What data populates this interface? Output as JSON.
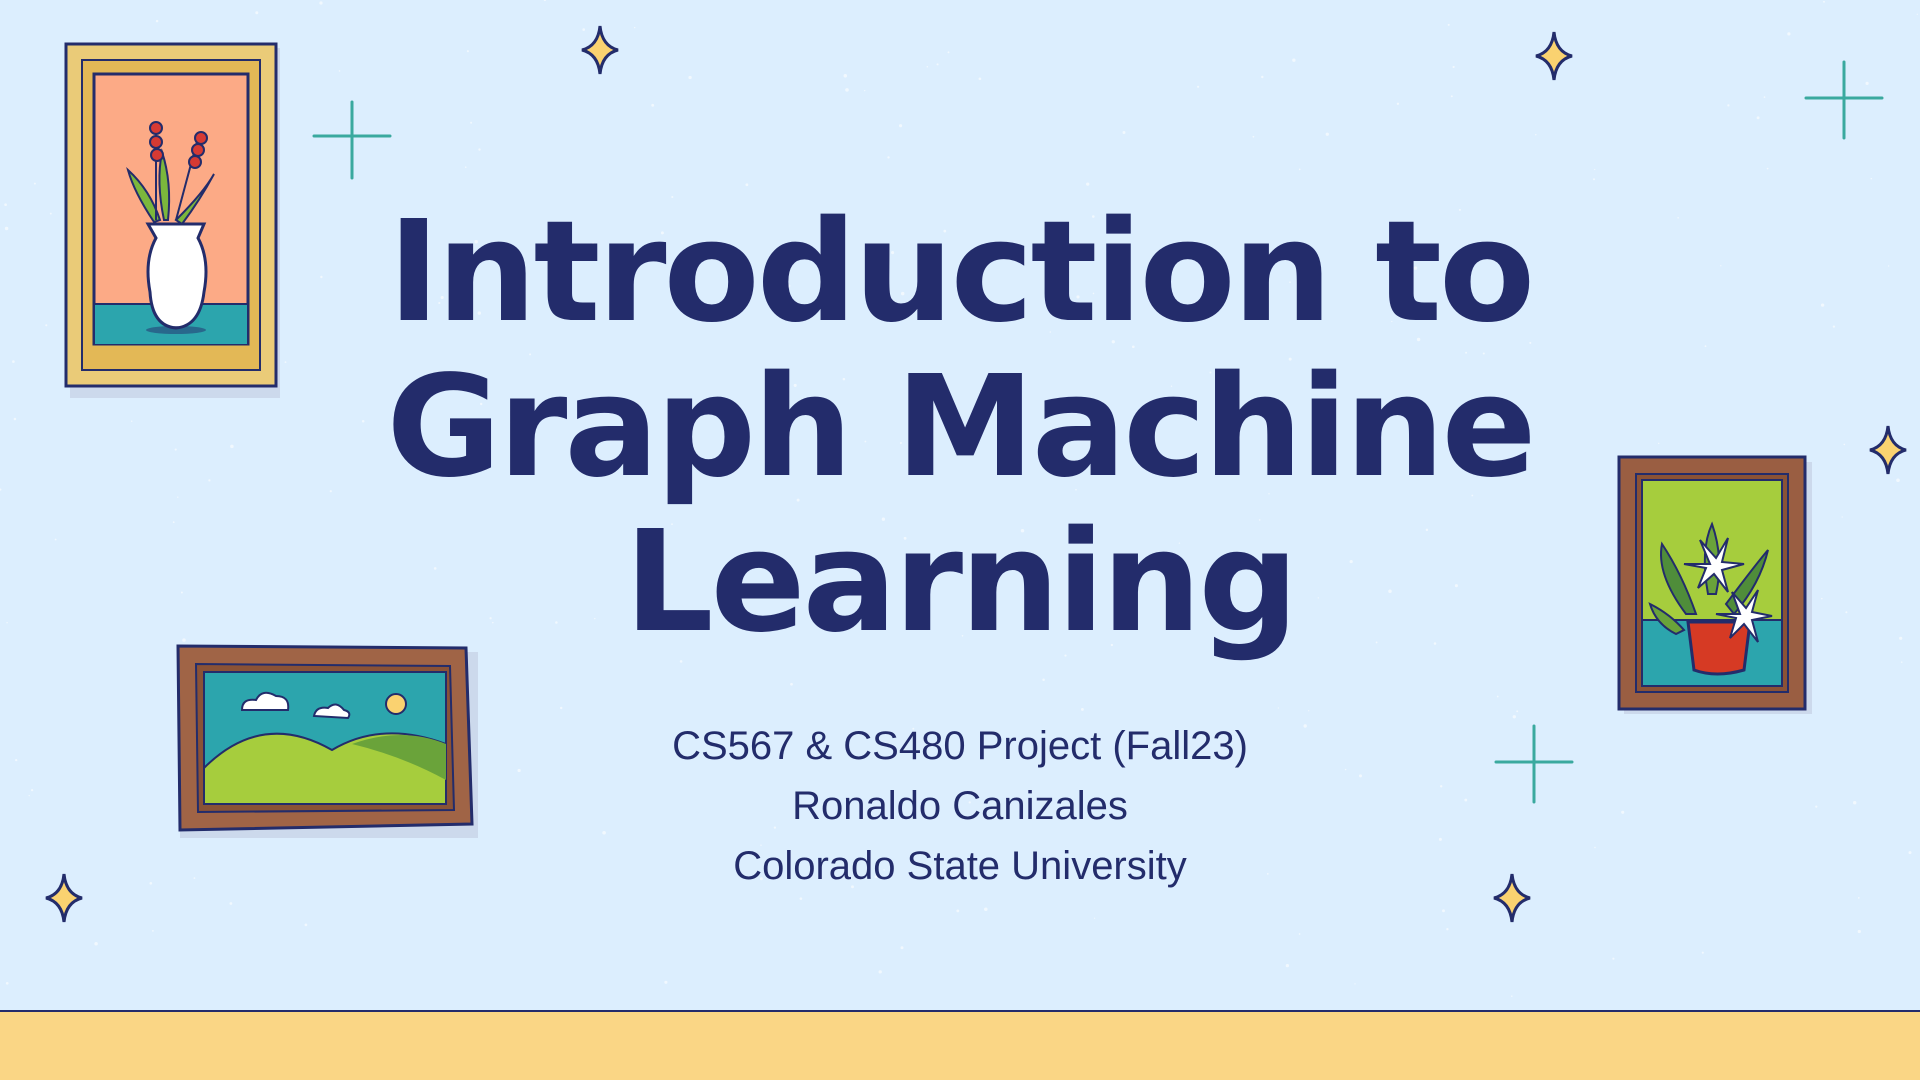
{
  "slide": {
    "title_lines": [
      "Introduction to",
      "Graph Machine",
      "Learning"
    ],
    "subtitle_lines": [
      "CS567 & CS480 Project (Fall23)",
      "Ronaldo Canizales",
      "Colorado State University"
    ]
  },
  "decorations": {
    "frames": [
      "vase-painting-icon",
      "landscape-painting-icon",
      "plant-painting-icon"
    ],
    "stars": [
      "sparkle-icon",
      "plus-sparkle-icon"
    ]
  },
  "colors": {
    "background": "#dceefe",
    "title": "#232c6b",
    "floor": "#fad685",
    "star": "#fad270",
    "teal_sparkle": "#3aa99f"
  }
}
